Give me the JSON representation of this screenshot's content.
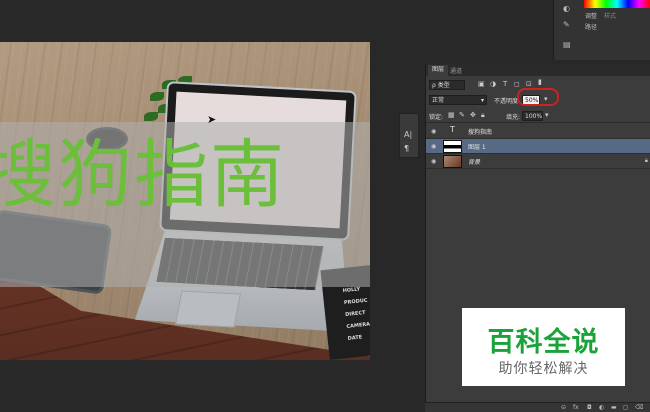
{
  "canvas": {
    "overlay_text": "搜狗指南",
    "clapper_lines": [
      "HOLLY",
      "PRODUC",
      "DIRECT",
      "CAMERA",
      "DATE"
    ]
  },
  "top_strip": {
    "tab_adjust": "调整",
    "tab_style": "样式",
    "tab_paths": "路径"
  },
  "mini_tools": {
    "text_tool": "A|",
    "para_tool": "¶"
  },
  "layers_panel": {
    "tabs": [
      "图层",
      "通道"
    ],
    "filter_kind": "类型",
    "blend_mode": "正常",
    "opacity_label": "不透明度:",
    "opacity_value": "50%",
    "lock_label": "锁定:",
    "fill_label": "填充:",
    "fill_value": "100%",
    "layers": [
      {
        "name": "搜狗指南",
        "kind": "text",
        "selected": false
      },
      {
        "name": "图层 1",
        "kind": "pixel",
        "selected": true
      },
      {
        "name": "背景",
        "kind": "background",
        "selected": false
      }
    ]
  },
  "watermark": {
    "main": "百科全说",
    "sub": "助你轻松解决",
    "colors": {
      "main": "#1aa33a",
      "sub": "#666666"
    }
  },
  "colors": {
    "overlay_text": "#6bbf3a",
    "selected_layer": "#566a85",
    "highlight_ring": "#d02020"
  }
}
